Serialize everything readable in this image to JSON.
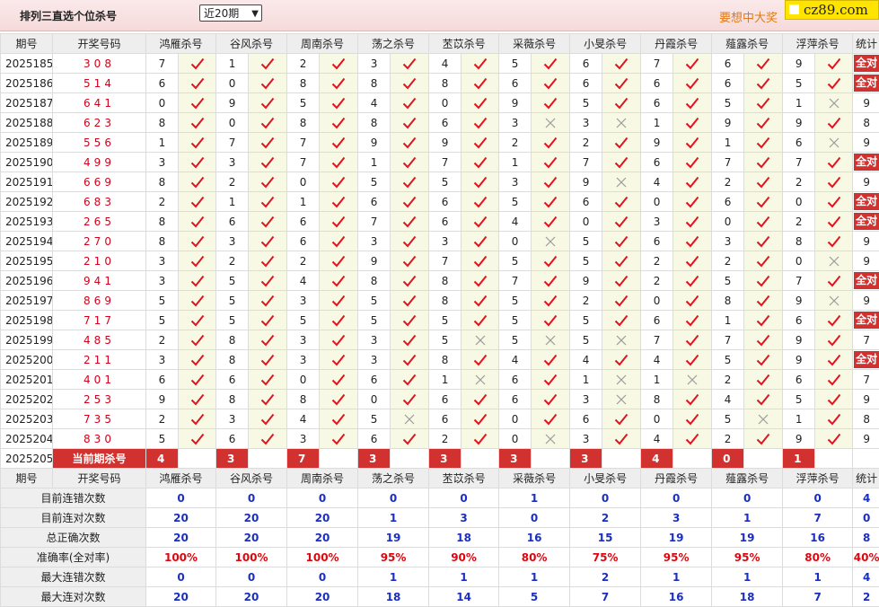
{
  "header": {
    "title": "排列三直选个位杀号",
    "range_select": "近20期",
    "slogan": "要想中大奖",
    "logo_text": "cz89.com"
  },
  "columns": {
    "period": "期号",
    "draw": "开奖号码",
    "experts": [
      "鸿雁杀号",
      "谷风杀号",
      "周南杀号",
      "荡之杀号",
      "苤苡杀号",
      "采薇杀号",
      "小旻杀号",
      "丹霞杀号",
      "薤露杀号",
      "浮萍杀号"
    ],
    "total": "统计"
  },
  "rows": [
    {
      "period": "2025185",
      "draw": "308",
      "kills": [
        7,
        1,
        2,
        3,
        4,
        5,
        6,
        7,
        6,
        9
      ],
      "ok": [
        1,
        1,
        1,
        1,
        1,
        1,
        1,
        1,
        1,
        1
      ],
      "total": "全对"
    },
    {
      "period": "2025186",
      "draw": "514",
      "kills": [
        6,
        0,
        8,
        8,
        8,
        6,
        6,
        6,
        6,
        5
      ],
      "ok": [
        1,
        1,
        1,
        1,
        1,
        1,
        1,
        1,
        1,
        1
      ],
      "total": "全对"
    },
    {
      "period": "2025187",
      "draw": "641",
      "kills": [
        0,
        9,
        5,
        4,
        0,
        9,
        5,
        6,
        5,
        1
      ],
      "ok": [
        1,
        1,
        1,
        1,
        1,
        1,
        1,
        1,
        1,
        0
      ],
      "total": "9"
    },
    {
      "period": "2025188",
      "draw": "623",
      "kills": [
        8,
        0,
        8,
        8,
        6,
        3,
        3,
        1,
        9,
        9
      ],
      "ok": [
        1,
        1,
        1,
        1,
        1,
        0,
        0,
        1,
        1,
        1
      ],
      "total": "8"
    },
    {
      "period": "2025189",
      "draw": "556",
      "kills": [
        1,
        7,
        7,
        9,
        9,
        2,
        2,
        9,
        1,
        6
      ],
      "ok": [
        1,
        1,
        1,
        1,
        1,
        1,
        1,
        1,
        1,
        0
      ],
      "total": "9"
    },
    {
      "period": "2025190",
      "draw": "499",
      "kills": [
        3,
        3,
        7,
        1,
        7,
        1,
        7,
        6,
        7,
        7
      ],
      "ok": [
        1,
        1,
        1,
        1,
        1,
        1,
        1,
        1,
        1,
        1
      ],
      "total": "全对"
    },
    {
      "period": "2025191",
      "draw": "669",
      "kills": [
        8,
        2,
        0,
        5,
        5,
        3,
        9,
        4,
        2,
        2
      ],
      "ok": [
        1,
        1,
        1,
        1,
        1,
        1,
        0,
        1,
        1,
        1
      ],
      "total": "9"
    },
    {
      "period": "2025192",
      "draw": "683",
      "kills": [
        2,
        1,
        1,
        6,
        6,
        5,
        6,
        0,
        6,
        0
      ],
      "ok": [
        1,
        1,
        1,
        1,
        1,
        1,
        1,
        1,
        1,
        1
      ],
      "total": "全对"
    },
    {
      "period": "2025193",
      "draw": "265",
      "kills": [
        8,
        6,
        6,
        7,
        6,
        4,
        0,
        3,
        0,
        2
      ],
      "ok": [
        1,
        1,
        1,
        1,
        1,
        1,
        1,
        1,
        1,
        1
      ],
      "total": "全对"
    },
    {
      "period": "2025194",
      "draw": "270",
      "kills": [
        8,
        3,
        6,
        3,
        3,
        0,
        5,
        6,
        3,
        8
      ],
      "ok": [
        1,
        1,
        1,
        1,
        1,
        0,
        1,
        1,
        1,
        1
      ],
      "total": "9"
    },
    {
      "period": "2025195",
      "draw": "210",
      "kills": [
        3,
        2,
        2,
        9,
        7,
        5,
        5,
        2,
        2,
        0
      ],
      "ok": [
        1,
        1,
        1,
        1,
        1,
        1,
        1,
        1,
        1,
        0
      ],
      "total": "9"
    },
    {
      "period": "2025196",
      "draw": "941",
      "kills": [
        3,
        5,
        4,
        8,
        8,
        7,
        9,
        2,
        5,
        7
      ],
      "ok": [
        1,
        1,
        1,
        1,
        1,
        1,
        1,
        1,
        1,
        1
      ],
      "total": "全对"
    },
    {
      "period": "2025197",
      "draw": "869",
      "kills": [
        5,
        5,
        3,
        5,
        8,
        5,
        2,
        0,
        8,
        9
      ],
      "ok": [
        1,
        1,
        1,
        1,
        1,
        1,
        1,
        1,
        1,
        0
      ],
      "total": "9"
    },
    {
      "period": "2025198",
      "draw": "717",
      "kills": [
        5,
        5,
        5,
        5,
        5,
        5,
        5,
        6,
        1,
        6
      ],
      "ok": [
        1,
        1,
        1,
        1,
        1,
        1,
        1,
        1,
        1,
        1
      ],
      "total": "全对"
    },
    {
      "period": "2025199",
      "draw": "485",
      "kills": [
        2,
        8,
        3,
        3,
        5,
        5,
        5,
        7,
        7,
        9
      ],
      "ok": [
        1,
        1,
        1,
        1,
        0,
        0,
        0,
        1,
        1,
        1
      ],
      "total": "7"
    },
    {
      "period": "2025200",
      "draw": "211",
      "kills": [
        3,
        8,
        3,
        3,
        8,
        4,
        4,
        4,
        5,
        9
      ],
      "ok": [
        1,
        1,
        1,
        1,
        1,
        1,
        1,
        1,
        1,
        1
      ],
      "total": "全对"
    },
    {
      "period": "2025201",
      "draw": "401",
      "kills": [
        6,
        6,
        0,
        6,
        1,
        6,
        1,
        1,
        2,
        6
      ],
      "ok": [
        1,
        1,
        1,
        1,
        0,
        1,
        0,
        0,
        1,
        1
      ],
      "total": "7"
    },
    {
      "period": "2025202",
      "draw": "253",
      "kills": [
        9,
        8,
        8,
        0,
        6,
        6,
        3,
        8,
        4,
        5
      ],
      "ok": [
        1,
        1,
        1,
        1,
        1,
        1,
        0,
        1,
        1,
        1
      ],
      "total": "9"
    },
    {
      "period": "2025203",
      "draw": "735",
      "kills": [
        2,
        3,
        4,
        5,
        6,
        0,
        6,
        0,
        5,
        1
      ],
      "ok": [
        1,
        1,
        1,
        0,
        1,
        1,
        1,
        1,
        0,
        1
      ],
      "total": "8"
    },
    {
      "period": "2025204",
      "draw": "830",
      "kills": [
        5,
        6,
        3,
        6,
        2,
        0,
        3,
        4,
        2,
        9
      ],
      "ok": [
        1,
        1,
        1,
        1,
        1,
        0,
        1,
        1,
        1,
        1
      ],
      "total": "9"
    }
  ],
  "current": {
    "period": "2025205",
    "label": "当前期杀号",
    "kills": [
      "4",
      "3",
      "7",
      "3",
      "3",
      "3",
      "3",
      "4",
      "0",
      "1"
    ]
  },
  "stats": [
    {
      "label": "目前连错次数",
      "color": "blue",
      "values": [
        "0",
        "0",
        "0",
        "0",
        "0",
        "1",
        "0",
        "0",
        "0",
        "0",
        "4"
      ]
    },
    {
      "label": "目前连对次数",
      "color": "blue",
      "values": [
        "20",
        "20",
        "20",
        "1",
        "3",
        "0",
        "2",
        "3",
        "1",
        "7",
        "0"
      ]
    },
    {
      "label": "总正确次数",
      "color": "blue",
      "values": [
        "20",
        "20",
        "20",
        "19",
        "18",
        "16",
        "15",
        "19",
        "19",
        "16",
        "8"
      ]
    },
    {
      "label": "准确率(全对率)",
      "color": "red",
      "values": [
        "100%",
        "100%",
        "100%",
        "95%",
        "90%",
        "80%",
        "75%",
        "95%",
        "95%",
        "80%",
        "40%"
      ]
    },
    {
      "label": "最大连错次数",
      "color": "blue",
      "values": [
        "0",
        "0",
        "0",
        "1",
        "1",
        "1",
        "2",
        "1",
        "1",
        "1",
        "4"
      ]
    },
    {
      "label": "最大连对次数",
      "color": "blue",
      "values": [
        "20",
        "20",
        "20",
        "18",
        "14",
        "5",
        "7",
        "16",
        "18",
        "7",
        "2"
      ]
    }
  ],
  "colors": {
    "accent_red": "#d1322f",
    "check_red": "#e0141e",
    "cross_gray": "#9a9a9a",
    "stat_blue": "#1a2fc0",
    "slogan_orange": "#e07a13"
  }
}
